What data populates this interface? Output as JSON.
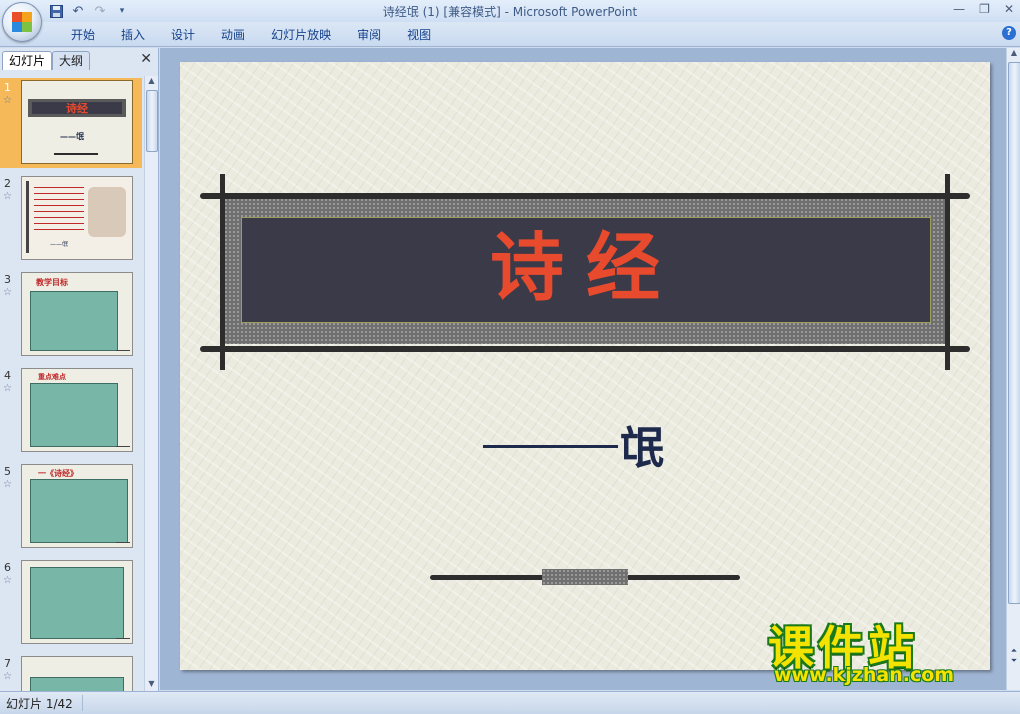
{
  "window": {
    "title_doc": "诗经氓 (1) [兼容模式]",
    "title_app": " - Microsoft PowerPoint"
  },
  "quick_access": [
    "save-icon",
    "undo-icon",
    "redo-icon",
    "customize-icon"
  ],
  "ribbon": {
    "tabs": [
      "开始",
      "插入",
      "设计",
      "动画",
      "幻灯片放映",
      "审阅",
      "视图"
    ],
    "help": "?"
  },
  "left_panel": {
    "tab_slides": "幻灯片",
    "tab_outline": "大纲",
    "close": "✕",
    "thumbnails": [
      {
        "num": "1",
        "mini_title": "诗经",
        "mini_sub": "——氓"
      },
      {
        "num": "2",
        "mini_title": "",
        "mini_sub": "——氓"
      },
      {
        "num": "3",
        "mini_title": "教学目标",
        "mini_sub": ""
      },
      {
        "num": "4",
        "mini_title": "重点难点",
        "mini_sub": ""
      },
      {
        "num": "5",
        "mini_title": "一《诗经》",
        "mini_sub": ""
      },
      {
        "num": "6",
        "mini_title": "",
        "mini_sub": ""
      },
      {
        "num": "7",
        "mini_title": "",
        "mini_sub": ""
      }
    ]
  },
  "slide": {
    "title": "诗经",
    "subtitle": "氓"
  },
  "status": {
    "slide_info": "幻灯片 1/42"
  },
  "watermark": {
    "main": "课件站",
    "url": "www.kjzhan.com"
  }
}
